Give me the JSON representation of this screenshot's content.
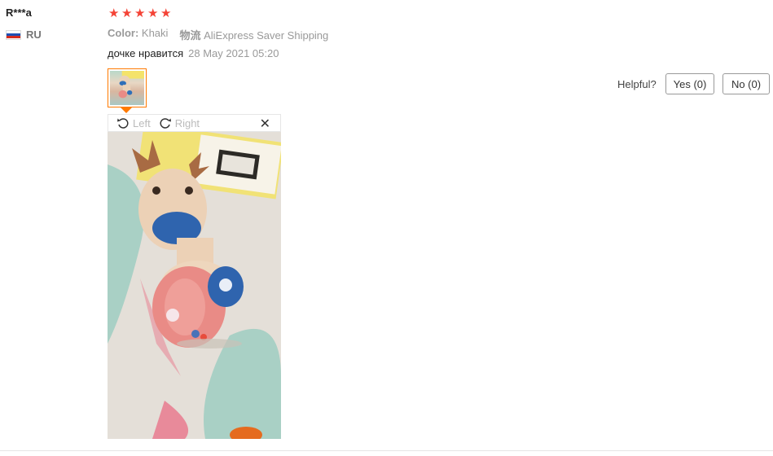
{
  "review": {
    "user_name": "R***a",
    "country_code": "RU",
    "rating": 5,
    "stars": [
      "★",
      "★",
      "★",
      "★",
      "★"
    ],
    "color_label": "Color:",
    "color_value": "Khaki",
    "shipping_label": "物流",
    "shipping_value": "AliExpress Saver Shipping",
    "text": "дочке нравится",
    "date": "28 May 2021 05:20"
  },
  "image_viewer": {
    "rotate_left_label": "Left",
    "rotate_right_label": "Right",
    "close_glyph": "✕"
  },
  "feedback": {
    "helpful_label": "Helpful?",
    "yes_label": "Yes (0)",
    "no_label": "No (0)"
  },
  "colors": {
    "star": "#f44336",
    "accent": "#ff7a00"
  }
}
